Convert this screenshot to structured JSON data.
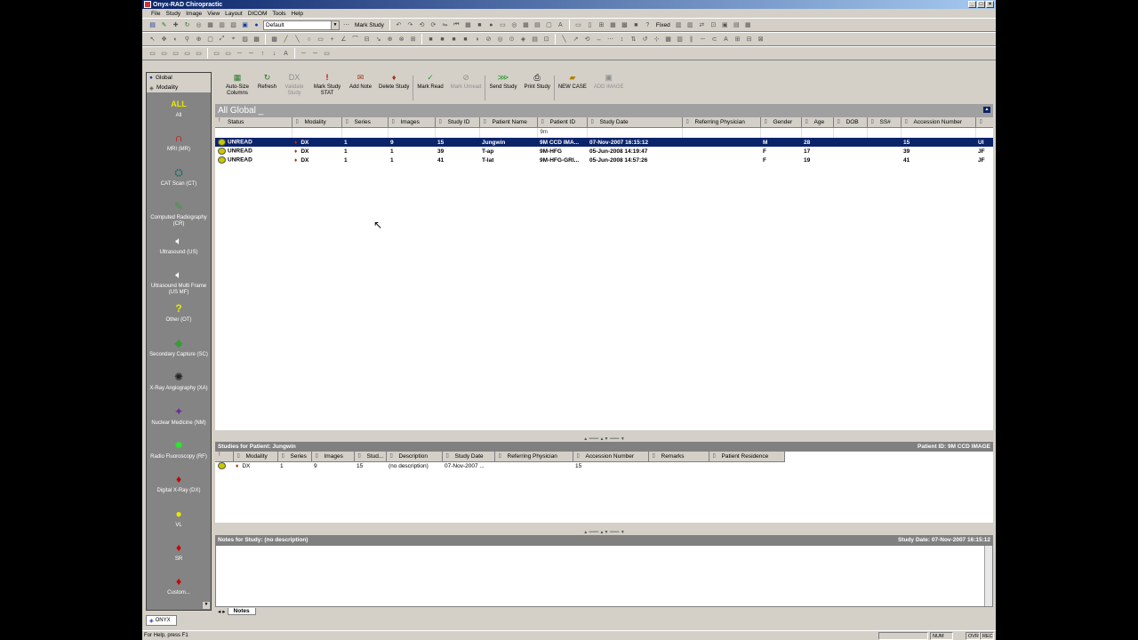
{
  "window": {
    "title": "Onyx-RAD Chiropractic"
  },
  "menu": [
    "File",
    "Study",
    "Image",
    "View",
    "Layout",
    "DICOM",
    "Tools",
    "Help"
  ],
  "toolbar": {
    "layout_combo": "Default",
    "mark_study_label": "Mark Study",
    "fixed_label": "Fixed"
  },
  "sidebar": {
    "global_label": "Global",
    "modality_label": "Modality",
    "items": [
      {
        "label": "ALL",
        "sub": "All",
        "icon": "all-icon"
      },
      {
        "label": "MRI (MR)",
        "icon": "mri-icon"
      },
      {
        "label": "CAT Scan (CT)",
        "icon": "ct-icon"
      },
      {
        "label": "Computed Radiography (CR)",
        "icon": "cr-icon"
      },
      {
        "label": "Ultrasound (US)",
        "icon": "speaker-icon"
      },
      {
        "label": "Ultrasound Multi Frame (US MF)",
        "icon": "speaker-icon"
      },
      {
        "label": "Other (OT)",
        "icon": "question-icon"
      },
      {
        "label": "Secondary Capture (SC)",
        "icon": "sc-icon"
      },
      {
        "label": "X-Ray Angiography (XA)",
        "icon": "xa-icon"
      },
      {
        "label": "Nuclear Medicine (NM)",
        "icon": "nm-icon"
      },
      {
        "label": "Radio Fluoroscopy (RF)",
        "icon": "rf-icon"
      },
      {
        "label": "Digital X-Ray (DX)",
        "icon": "dx-icon"
      },
      {
        "label": "VL",
        "icon": "bulb-icon"
      },
      {
        "label": "SR",
        "icon": "sr-icon"
      },
      {
        "label": "Custom...",
        "icon": "custom-icon"
      }
    ]
  },
  "actions": [
    {
      "label": "Auto-Size Columns",
      "icon": "autosize-icon",
      "disabled": false
    },
    {
      "label": "Refresh",
      "icon": "refresh-icon",
      "disabled": false
    },
    {
      "label": "Validate Study",
      "icon": "validate-icon",
      "disabled": true
    },
    {
      "label": "Mark Study STAT",
      "icon": "stat-icon",
      "disabled": false
    },
    {
      "label": "Add Note",
      "icon": "note-icon",
      "disabled": false
    },
    {
      "label": "Delete Study",
      "icon": "delete-icon",
      "disabled": false
    },
    {
      "label": "Mark Read",
      "icon": "check-icon",
      "disabled": false
    },
    {
      "label": "Mark Unread",
      "icon": "unread-icon",
      "disabled": true
    },
    {
      "label": "Send Study",
      "icon": "send-icon",
      "disabled": false
    },
    {
      "label": "Print Study",
      "icon": "print-icon",
      "disabled": false
    },
    {
      "label": "NEW CASE",
      "icon": "newcase-icon",
      "disabled": false
    },
    {
      "label": "ADD IMAGE",
      "icon": "addimage-icon",
      "disabled": true
    }
  ],
  "grid": {
    "title": "All Global _",
    "filter_patient_id": "9m",
    "columns": [
      "Status",
      "Modality",
      "Series",
      "Images",
      "Study ID",
      "Patient Name",
      "Patient ID",
      "Study Date",
      "Referring Physician",
      "Gender",
      "Age",
      "DOB",
      "SS#",
      "Accession Number"
    ],
    "rows": [
      {
        "status": "UNREAD",
        "modality": "DX",
        "series": "1",
        "images": "9",
        "study_id": "15",
        "patient_name": "Jungwin",
        "patient_id": "9M CCD IMA...",
        "study_date": "07-Nov-2007 16:15:12",
        "referring": "",
        "gender": "M",
        "age": "28",
        "dob": "",
        "ss": "",
        "accession": "15",
        "extra": "UI",
        "selected": true
      },
      {
        "status": "UNREAD",
        "modality": "DX",
        "series": "1",
        "images": "1",
        "study_id": "39",
        "patient_name": "T-ap",
        "patient_id": "9M-HFG",
        "study_date": "05-Jun-2008 14:19:47",
        "referring": "",
        "gender": "F",
        "age": "17",
        "dob": "",
        "ss": "",
        "accession": "39",
        "extra": "JF",
        "selected": false
      },
      {
        "status": "UNREAD",
        "modality": "DX",
        "series": "1",
        "images": "1",
        "study_id": "41",
        "patient_name": "T-lat",
        "patient_id": "9M-HFG-GRI...",
        "study_date": "05-Jun-2008 14:57:26",
        "referring": "",
        "gender": "F",
        "age": "19",
        "dob": "",
        "ss": "",
        "accession": "41",
        "extra": "JF",
        "selected": false
      }
    ]
  },
  "studies": {
    "title": "Studies for Patient: Jungwin",
    "patient_id_label": "Patient ID: 9M CCD IMAGE",
    "columns": [
      "Modality",
      "Series",
      "Images",
      "Stud...",
      "Description",
      "Study Date",
      "Referring Physician",
      "Accession Number",
      "Remarks",
      "Patient Residence"
    ],
    "rows": [
      {
        "modality": "DX",
        "series": "1",
        "images": "9",
        "study": "15",
        "description": "(no description)",
        "study_date": "07-Nov-2007 ...",
        "referring": "",
        "accession": "15",
        "remarks": "",
        "residence": ""
      }
    ]
  },
  "notes": {
    "title": "Notes for Study: (no description)",
    "study_date": "Study Date: 07-Nov-2007 16:15:12",
    "tab_label": "Notes"
  },
  "bottom_tab": "ONYX",
  "status": {
    "help": "For Help, press F1",
    "num": "NUM",
    "ovr": "OVR",
    "rec": "REC"
  }
}
